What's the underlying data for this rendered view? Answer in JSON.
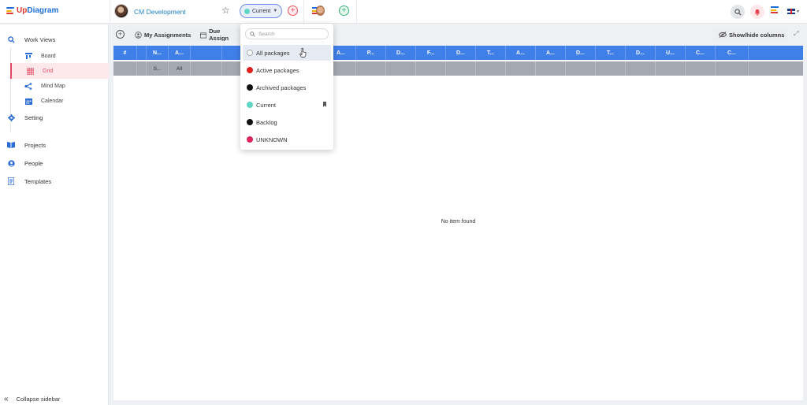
{
  "app": {
    "logo_prefix": "Up",
    "logo_suffix": "Diagram",
    "logo_colors": [
      "#1f6fd8",
      "#f5b400",
      "#e0362f",
      "#34b37a"
    ]
  },
  "header": {
    "project_name": "CM Development",
    "package_selector": {
      "label": "Current",
      "dot_color": "#5fd6c4"
    },
    "icons": [
      "star-icon",
      "add-icon",
      "team-logo",
      "add-icon",
      "search-icon",
      "bell-icon",
      "menu-icon",
      "flag-icon"
    ]
  },
  "sidebar": {
    "work_views": "Work Views",
    "sub_items": [
      {
        "label": "Board",
        "icon": "board-icon"
      },
      {
        "label": "Grid",
        "icon": "grid-icon",
        "active": true
      },
      {
        "label": "Mind Map",
        "icon": "mindmap-icon"
      },
      {
        "label": "Calendar",
        "icon": "calendar-icon"
      }
    ],
    "setting": "Setting",
    "projects": "Projects",
    "people": "People",
    "templates": "Templates",
    "collapse": "Collapse sidebar"
  },
  "toolbar": {
    "my_assignments": "My Assignments",
    "due_assignments": "Due Assign",
    "show_hide": "Show/hide columns"
  },
  "grid": {
    "columns": [
      "#",
      "",
      "N...",
      "A...",
      "",
      "",
      "",
      "S...",
      "P...",
      "A...",
      "P...",
      "D...",
      "F...",
      "D...",
      "T...",
      "A...",
      "A...",
      "D...",
      "T...",
      "D...",
      "U...",
      "C...",
      "C..."
    ],
    "filter_row": [
      "",
      "",
      "S...",
      "All",
      "",
      "",
      "",
      "",
      "",
      "",
      "",
      "",
      "",
      "",
      "",
      "",
      "",
      "",
      "",
      "",
      "",
      "",
      ""
    ],
    "empty_message": "No item found"
  },
  "dropdown": {
    "search_placeholder": "Search",
    "options": [
      {
        "label": "All packages",
        "dot_color": "#ffffff",
        "hovered": true
      },
      {
        "label": "Active packages",
        "dot_color": "#e01f1f"
      },
      {
        "label": "Archived packages",
        "dot_color": "#111111"
      },
      {
        "label": "Current",
        "dot_color": "#5fd6c4",
        "bookmarked": true
      },
      {
        "label": "Backlog",
        "dot_color": "#111111"
      },
      {
        "label": "UNKNOWN",
        "dot_color": "#e0245e"
      }
    ]
  }
}
